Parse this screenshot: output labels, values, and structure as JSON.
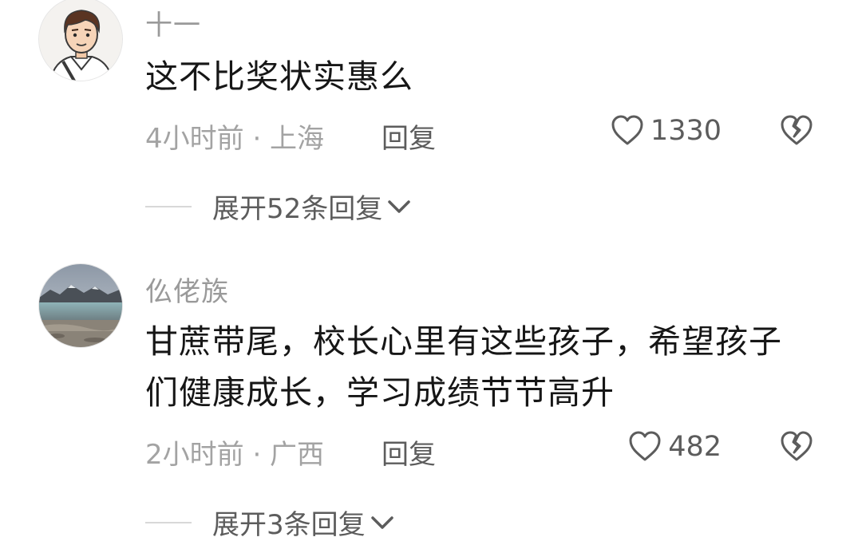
{
  "comments": [
    {
      "username": "十一",
      "content": "这不比奖状实惠么",
      "time_location": "4小时前 · 上海",
      "reply_label": "回复",
      "likes": "1330",
      "expand_label": "展开52条回复",
      "avatar_icon": "cartoon-boy-avatar"
    },
    {
      "username": "仫佬族",
      "content": "甘蔗带尾，校长心里有这些孩子，希望孩子们健康成长，学习成绩节节高升",
      "time_location": "2小时前 · 广西",
      "reply_label": "回复",
      "likes": "482",
      "expand_label": "展开3条回复",
      "avatar_icon": "lake-landscape-avatar"
    }
  ],
  "icons": {
    "like": "heart-outline-icon",
    "dislike": "broken-heart-icon",
    "expand": "chevron-down-icon"
  },
  "colors": {
    "username": "#9a9a9a",
    "content": "#161616",
    "meta": "#a3a3a3",
    "action": "#5c5c5c"
  }
}
